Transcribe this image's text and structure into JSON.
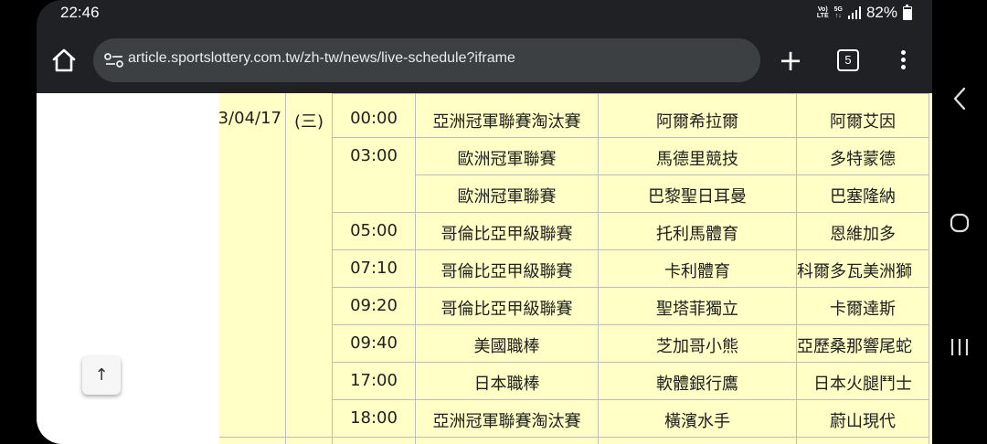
{
  "status_bar": {
    "time": "22:46",
    "volte_top": "Vo)",
    "volte_bottom": "LTE",
    "network_top": "5G",
    "network_bottom": "↑↓",
    "battery_percent": "82%"
  },
  "browser": {
    "url": "article.sportslottery.com.tw/zh-tw/news/live-schedule?iframe",
    "tab_count": "5",
    "new_tab_label": "+"
  },
  "schedule": {
    "date": "3/04/17",
    "weekday": "(三)",
    "rows": [
      {
        "time": "00:00",
        "league": "亞洲冠軍聯賽淘汰賽",
        "home": "阿爾希拉爾",
        "away": "阿爾艾因"
      },
      {
        "time": "03:00",
        "league": "歐洲冠軍聯賽",
        "home": "馬德里競技",
        "away": "多特蒙德"
      },
      {
        "time": "",
        "league": "歐洲冠軍聯賽",
        "home": "巴黎聖日耳曼",
        "away": "巴塞隆納"
      },
      {
        "time": "05:00",
        "league": "哥倫比亞甲級聯賽",
        "home": "托利馬體育",
        "away": "恩維加多"
      },
      {
        "time": "07:10",
        "league": "哥倫比亞甲級聯賽",
        "home": "卡利體育",
        "away": "科爾多瓦美洲獅"
      },
      {
        "time": "09:20",
        "league": "哥倫比亞甲級聯賽",
        "home": "聖塔菲獨立",
        "away": "卡爾達斯"
      },
      {
        "time": "09:40",
        "league": "美國職棒",
        "home": "芝加哥小熊",
        "away": "亞歷桑那響尾蛇"
      },
      {
        "time": "17:00",
        "league": "日本職棒",
        "home": "軟體銀行鷹",
        "away": "日本火腿鬥士"
      },
      {
        "time": "18:00",
        "league": "亞洲冠軍聯賽淘汰賽",
        "home": "橫濱水手",
        "away": "蔚山現代"
      }
    ]
  },
  "scroll_top": {
    "label": "↑"
  }
}
